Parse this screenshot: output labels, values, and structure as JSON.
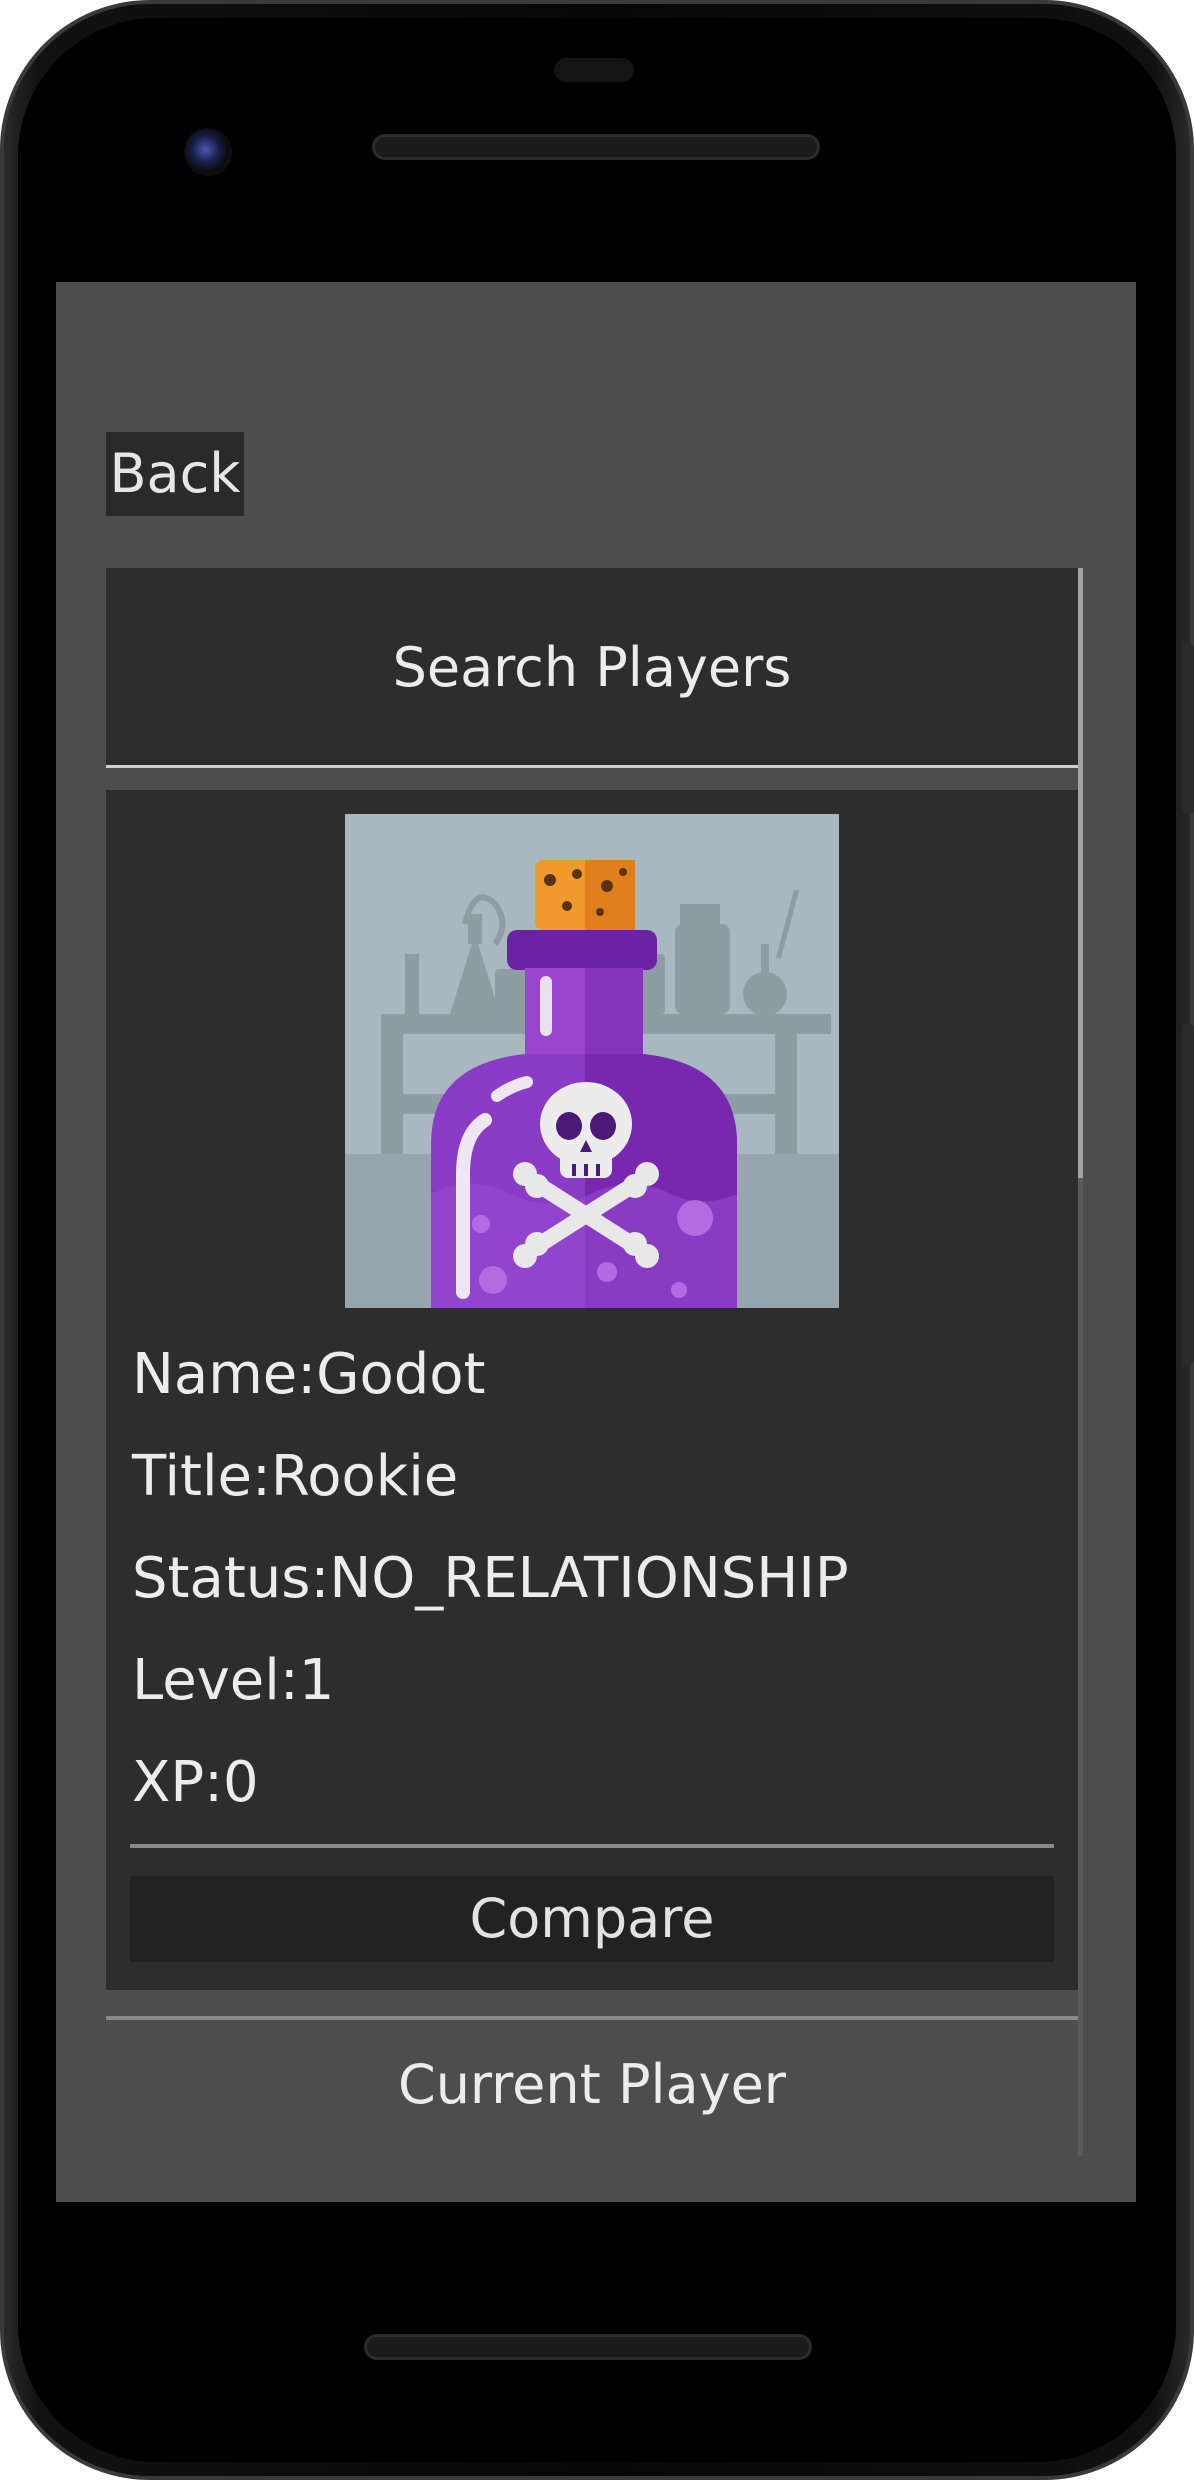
{
  "app": {
    "back_label": "Back",
    "search_title": "Search Players",
    "current_player_label": "Current Player"
  },
  "player": {
    "avatar_icon": "poison-bottle-icon",
    "name_label": "Name:",
    "name_value": "Godot",
    "title_label": "Title:",
    "title_value": "Rookie",
    "status_label": "Status:",
    "status_value": "NO_RELATIONSHIP",
    "level_label": "Level:",
    "level_value": "1",
    "xp_label": "XP:",
    "xp_value": "0",
    "compare_label": "Compare"
  },
  "colors": {
    "screen_bg": "#4d4d4d",
    "panel_bg": "#2d2d2d",
    "text": "#ececec",
    "potion_purple": "#7b2fb0",
    "cork_orange": "#f0962a"
  }
}
